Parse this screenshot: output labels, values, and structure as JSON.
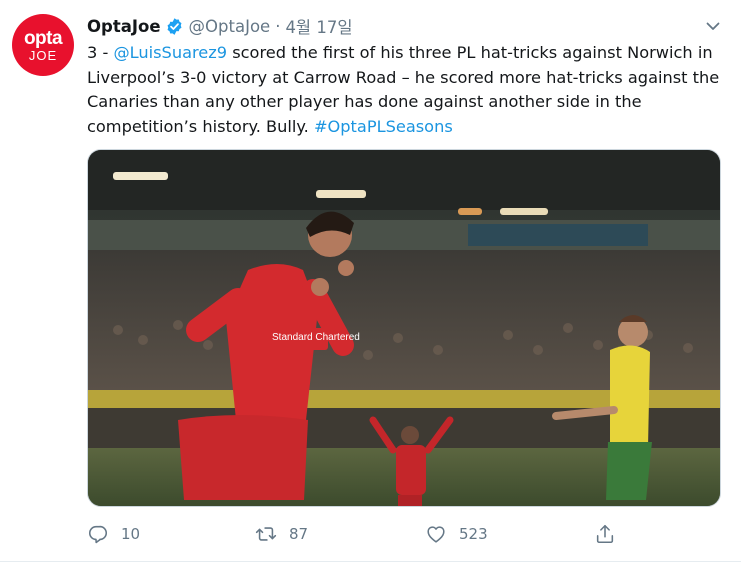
{
  "tweet": {
    "avatar": {
      "line1": "opta",
      "line2": "JOE",
      "color": "#e8112d"
    },
    "author_name": "OptaJoe",
    "handle": "@OptaJoe",
    "separator": "·",
    "timestamp": "4월 17일",
    "text_parts": [
      {
        "text": "3 - ",
        "link": false
      },
      {
        "text": "@LuisSuarez9",
        "link": true
      },
      {
        "text": " scored the first of his three PL hat-tricks against Norwich in Liverpool’s 3-0 victory at Carrow Road – he scored more hat-tricks against the Canaries than any other player has done against another side in the competition’s history. Bully. ",
        "link": false
      },
      {
        "text": "#OptaPLSeasons",
        "link": true
      }
    ],
    "media": {
      "description": "Football photo: player in red Liverpool kit with 'Standard Chartered' sponsor celebrating",
      "sponsor_text": "Standard Chartered"
    },
    "actions": {
      "reply": {
        "icon": "reply-icon",
        "count": "10"
      },
      "retweet": {
        "icon": "retweet-icon",
        "count": "87"
      },
      "like": {
        "icon": "heart-icon",
        "count": "523"
      },
      "share": {
        "icon": "share-icon"
      }
    },
    "colors": {
      "link": "#1b95e0",
      "muted": "#657786",
      "verified": "#1da1f2"
    }
  }
}
